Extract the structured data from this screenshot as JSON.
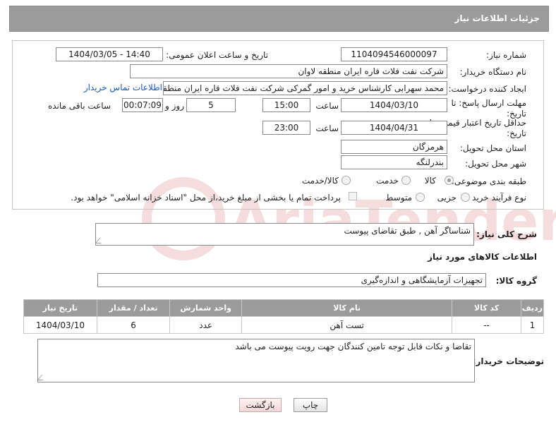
{
  "header": {
    "title": "جزئیات اطلاعات نیاز"
  },
  "fields": {
    "need_number_label": "شماره نیاز:",
    "need_number": "1104094546000097",
    "announce_label": "تاریخ و ساعت اعلان عمومی:",
    "announce_value": "1404/03/05 - 14:40",
    "buyer_org_label": "نام دستگاه خریدار:",
    "buyer_org": "شرکت نفت فلات قاره ایران منطقه لاوان",
    "creator_label": "ایجاد کننده درخواست:",
    "creator": "محمد سهرابی کارشناس خرید و امور گمرکی شرکت نفت فلات قاره ایران منطقه لاوان",
    "contact_link": "اطلاعات تماس خریدار",
    "deadline_label": "مهلت ارسال پاسخ: تا تاریخ:",
    "deadline_date": "1404/03/10",
    "time_label": "ساعت",
    "deadline_time": "15:00",
    "days_value": "5",
    "days_label": "روز و",
    "remaining_time": "00:07:09",
    "remaining_label": "ساعت باقی مانده",
    "validity_label": "حداقل تاریخ اعتبار قیمت: تا تاریخ:",
    "validity_date": "1404/04/31",
    "validity_time": "23:00",
    "province_label": "استان محل تحویل:",
    "province": "هرمزگان",
    "city_label": "شهر محل تحویل:",
    "city": "بندرلنگه",
    "category_label": "طبقه بندی موضوعی:",
    "category_options": [
      "کالا",
      "خدمت",
      "کالا/خدمت"
    ],
    "process_label": "نوع فرآیند خرید :",
    "process_options": [
      "جزیی",
      "متوسط"
    ],
    "payment_note": "پرداخت تمام یا بخشی از مبلغ خرید،از محل \"اسناد خزانه اسلامی\" خواهد بود."
  },
  "description": {
    "label": "شرح کلی نیاز:",
    "value": "شناساگر آهن , طبق تقاضای پیوست"
  },
  "goods": {
    "section_title": "اطلاعات کالاهای مورد نیاز",
    "group_label": "گروه کالا:",
    "group_value": "تجهیزات آزمایشگاهی و اندازه‌گیری",
    "columns": [
      "ردیف",
      "کد کالا",
      "نام کالا",
      "واحد شمارش",
      "تعداد / مقدار",
      "تاریخ نیاز"
    ],
    "rows": [
      [
        "1",
        "--",
        "تست آهن",
        "عدد",
        "6",
        "1404/03/10"
      ]
    ]
  },
  "buyer_notes": {
    "label": "توضیحات خریدار:",
    "value": "تقاضا و نکات قابل توجه تامین کنندگان جهت رویت پیوست می باشد"
  },
  "buttons": {
    "print": "چاپ",
    "back": "بازگشت"
  },
  "watermark": {
    "text": "AriaTender.net"
  }
}
